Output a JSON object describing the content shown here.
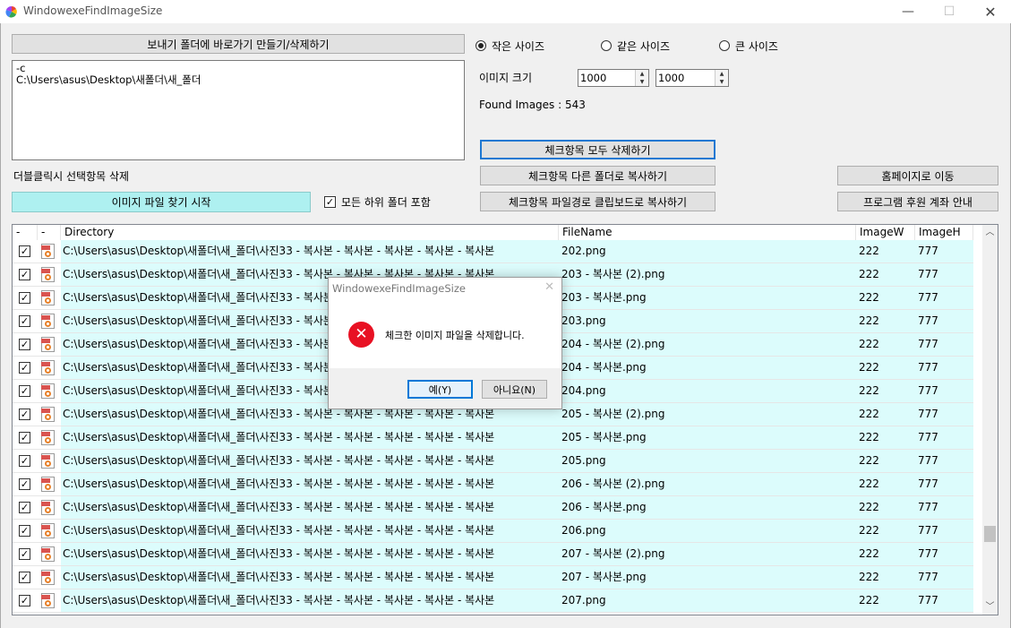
{
  "window": {
    "title": "WindowexeFindImageSize",
    "minimize": "—",
    "maximize": "☐",
    "close": "✕"
  },
  "controls": {
    "shortcut_button": "보내기 폴더에 바로가기 만들기/삭제하기",
    "path_text": "-c\nC:\\Users\\asus\\Desktop\\새폴더\\새_폴더",
    "double_click_label": "더블클릭시 선택항목 삭제",
    "start_button": "이미지 파일 찾기 시작",
    "include_subfolders": "모든 하위 폴더 포함",
    "include_subfolders_checked": true,
    "radio_small": "작은 사이즈",
    "radio_same": "같은 사이즈",
    "radio_large": "큰 사이즈",
    "selected_radio": "small",
    "image_size_label": "이미지 크기",
    "width_value": "1000",
    "height_value": "1000",
    "found_images": "Found Images : 543",
    "delete_checked": "체크항목 모두 삭제하기",
    "copy_checked": "체크항목 다른 폴더로 복사하기",
    "copy_paths": "체크항목 파일경로 클립보드로 복사하기",
    "homepage": "홈페이지로 이동",
    "sponsor": "프로그램 후원 계좌 안내"
  },
  "list": {
    "headers": {
      "check": "-",
      "icon": "-",
      "directory": "Directory",
      "filename": "FileName",
      "width": "ImageW",
      "height": "ImageH"
    },
    "rows": [
      {
        "dir": "C:\\Users\\asus\\Desktop\\새폴더\\새_폴더\\사진33 - 복사본 - 복사본 - 복사본 - 복사본 - 복사본",
        "file": "202.png",
        "w": "222",
        "h": "777"
      },
      {
        "dir": "C:\\Users\\asus\\Desktop\\새폴더\\새_폴더\\사진33 - 복사본 - 복사본 - 복사본 - 복사본 - 복사본",
        "file": "203 - 복사본 (2).png",
        "w": "222",
        "h": "777"
      },
      {
        "dir": "C:\\Users\\asus\\Desktop\\새폴더\\새_폴더\\사진33 - 복사본 - 복사본 - 복사본 - 복사본 - 복사본",
        "file": "203 - 복사본.png",
        "w": "222",
        "h": "777"
      },
      {
        "dir": "C:\\Users\\asus\\Desktop\\새폴더\\새_폴더\\사진33 - 복사본 - 복사본 - 복사본 - 복사본 - 복사본",
        "file": "203.png",
        "w": "222",
        "h": "777"
      },
      {
        "dir": "C:\\Users\\asus\\Desktop\\새폴더\\새_폴더\\사진33 - 복사본 - 복사본 - 복사본 - 복사본 - 복사본",
        "file": "204 - 복사본 (2).png",
        "w": "222",
        "h": "777"
      },
      {
        "dir": "C:\\Users\\asus\\Desktop\\새폴더\\새_폴더\\사진33 - 복사본 - 복사본 - 복사본 - 복사본 - 복사본",
        "file": "204 - 복사본.png",
        "w": "222",
        "h": "777"
      },
      {
        "dir": "C:\\Users\\asus\\Desktop\\새폴더\\새_폴더\\사진33 - 복사본 - 복사본 - 복사본 - 복사본 - 복사본",
        "file": "204.png",
        "w": "222",
        "h": "777"
      },
      {
        "dir": "C:\\Users\\asus\\Desktop\\새폴더\\새_폴더\\사진33 - 복사본 - 복사본 - 복사본 - 복사본 - 복사본",
        "file": "205 - 복사본 (2).png",
        "w": "222",
        "h": "777"
      },
      {
        "dir": "C:\\Users\\asus\\Desktop\\새폴더\\새_폴더\\사진33 - 복사본 - 복사본 - 복사본 - 복사본 - 복사본",
        "file": "205 - 복사본.png",
        "w": "222",
        "h": "777"
      },
      {
        "dir": "C:\\Users\\asus\\Desktop\\새폴더\\새_폴더\\사진33 - 복사본 - 복사본 - 복사본 - 복사본 - 복사본",
        "file": "205.png",
        "w": "222",
        "h": "777"
      },
      {
        "dir": "C:\\Users\\asus\\Desktop\\새폴더\\새_폴더\\사진33 - 복사본 - 복사본 - 복사본 - 복사본 - 복사본",
        "file": "206 - 복사본 (2).png",
        "w": "222",
        "h": "777"
      },
      {
        "dir": "C:\\Users\\asus\\Desktop\\새폴더\\새_폴더\\사진33 - 복사본 - 복사본 - 복사본 - 복사본 - 복사본",
        "file": "206 - 복사본.png",
        "w": "222",
        "h": "777"
      },
      {
        "dir": "C:\\Users\\asus\\Desktop\\새폴더\\새_폴더\\사진33 - 복사본 - 복사본 - 복사본 - 복사본 - 복사본",
        "file": "206.png",
        "w": "222",
        "h": "777"
      },
      {
        "dir": "C:\\Users\\asus\\Desktop\\새폴더\\새_폴더\\사진33 - 복사본 - 복사본 - 복사본 - 복사본 - 복사본",
        "file": "207 - 복사본 (2).png",
        "w": "222",
        "h": "777"
      },
      {
        "dir": "C:\\Users\\asus\\Desktop\\새폴더\\새_폴더\\사진33 - 복사본 - 복사본 - 복사본 - 복사본 - 복사본",
        "file": "207 - 복사본.png",
        "w": "222",
        "h": "777"
      },
      {
        "dir": "C:\\Users\\asus\\Desktop\\새폴더\\새_폴더\\사진33 - 복사본 - 복사본 - 복사본 - 복사본 - 복사본",
        "file": "207.png",
        "w": "222",
        "h": "777"
      }
    ]
  },
  "dialog": {
    "title": "WindowexeFindImageSize",
    "close": "✕",
    "message": "체크한 이미지 파일을 삭제합니다.",
    "yes": "예(Y)",
    "no": "아니요(N)",
    "icon": "error-icon"
  },
  "colors": {
    "start_button": "#aef0f0",
    "row_bg": "#dcfcfc",
    "error": "#e81123",
    "focus": "#1e78d2"
  }
}
